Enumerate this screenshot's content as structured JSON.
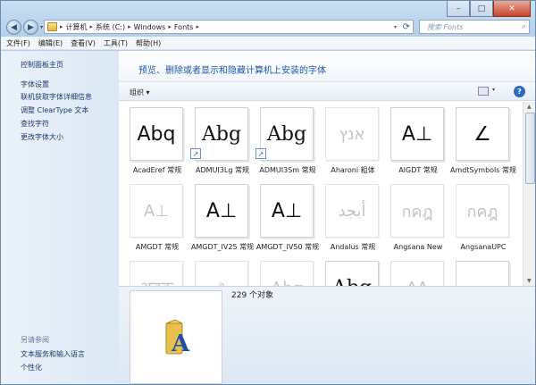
{
  "window": {
    "minimize": "–",
    "maximize": "□",
    "close": "✕"
  },
  "nav": {
    "back": "◀",
    "forward": "▶",
    "dropdown": "▾"
  },
  "address": {
    "crumbs": [
      "计算机",
      "系统 (C:)",
      "Windows",
      "Fonts"
    ],
    "separator": "▸"
  },
  "search": {
    "placeholder": "搜索 Fonts",
    "icon": "search-icon"
  },
  "menu": [
    "文件(F)",
    "编辑(E)",
    "查看(V)",
    "工具(T)",
    "帮助(H)"
  ],
  "sidebar": {
    "items": [
      "控制面板主页",
      "字体设置",
      "联机获取字体详细信息",
      "调整 ClearType 文本",
      "查找字符",
      "更改字体大小"
    ],
    "see_also_header": "另请参阅",
    "see_also": [
      "文本服务和输入语言",
      "个性化"
    ]
  },
  "banner_text": "预览、删除或者显示和隐藏计算机上安装的字体",
  "toolbar": {
    "organize": "组织 ▾",
    "view_dropdown": "▾",
    "help": "?"
  },
  "fonts": [
    {
      "name": "AcadEref 常规",
      "sample": "Abq",
      "shortcut": false,
      "faded": false
    },
    {
      "name": "ADMUI3Lg 常规",
      "sample": "Abg",
      "shortcut": true,
      "faded": false
    },
    {
      "name": "ADMUI3Sm 常规",
      "sample": "Abg",
      "shortcut": true,
      "faded": false
    },
    {
      "name": "Aharoni 粗体",
      "sample": "אנץ",
      "shortcut": false,
      "faded": true
    },
    {
      "name": "AIGDT 常规",
      "sample": "A⊥",
      "shortcut": false,
      "faded": false
    },
    {
      "name": "AmdtSymbols 常规",
      "sample": "∠",
      "shortcut": false,
      "faded": false
    },
    {
      "name": "AMGDT 常规",
      "sample": "A⊥",
      "shortcut": false,
      "faded": true
    },
    {
      "name": "AMGDT_IV25 常规",
      "sample": "A⊥",
      "shortcut": false,
      "faded": false
    },
    {
      "name": "AMGDT_IV50 常规",
      "sample": "A⊥",
      "shortcut": false,
      "faded": false
    },
    {
      "name": "Andalus 常规",
      "sample": "أبجد",
      "shortcut": false,
      "faded": true
    },
    {
      "name": "Angsana New",
      "sample": "กคฎ",
      "shortcut": false,
      "faded": true
    },
    {
      "name": "AngsanaUPC",
      "sample": "กคฎ",
      "shortcut": false,
      "faded": true
    },
    {
      "name": "",
      "sample": "अबक",
      "shortcut": false,
      "faded": true
    },
    {
      "name": "",
      "sample": "ᵃ",
      "shortcut": false,
      "faded": true
    },
    {
      "name": "",
      "sample": "Abg",
      "shortcut": false,
      "faded": true
    },
    {
      "name": "",
      "sample": "Abg",
      "shortcut": false,
      "faded": false
    },
    {
      "name": "",
      "sample": "A∆",
      "shortcut": false,
      "faded": true
    },
    {
      "name": "",
      "sample": "-.-",
      "shortcut": false,
      "faded": false
    }
  ],
  "scroll": {
    "up": "▲",
    "down": "▼"
  },
  "status": {
    "count": "229 个对象"
  }
}
